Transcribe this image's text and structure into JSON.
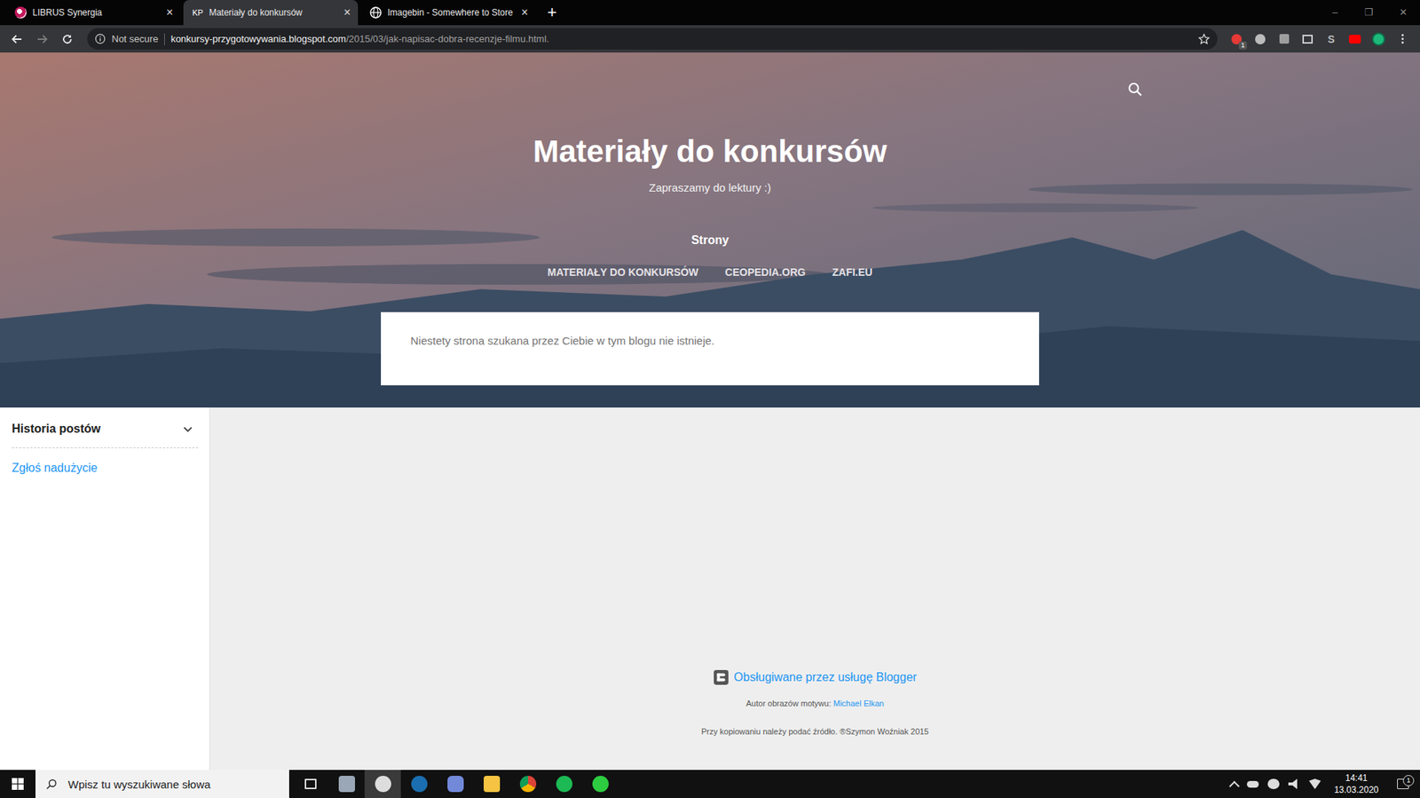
{
  "browser": {
    "tabs": [
      {
        "label": "LIBRUS Synergia",
        "selected": false,
        "favicon": "librus",
        "close": "×"
      },
      {
        "label": "Materiały do konkursów",
        "selected": true,
        "favicon": "text",
        "favicon_text": "KP",
        "close": "×"
      },
      {
        "label": "Imagebin - Somewhere to Store",
        "selected": false,
        "favicon": "globe",
        "close": "×"
      }
    ],
    "new_tab": "+",
    "window_controls": [
      "–",
      "❐",
      "✕"
    ],
    "address": {
      "security": "Not secure",
      "host": "konkursy-przygotowywania.blogspot.com",
      "path": "/2015/03/jak-napisac-dobra-recenzje-filmu.html."
    },
    "extension_badge": "1",
    "extension_letter": "S"
  },
  "blog": {
    "title": "Materiały do konkursów",
    "subtitle": "Zapraszamy do lektury :)",
    "pages_heading": "Strony",
    "pages": [
      "MATERIAŁY DO KONKURSÓW",
      "CEOPEDIA.ORG",
      "ZAFI.EU"
    ],
    "message": "Niestety strona szukana przez Ciebie w tym blogu nie istnieje."
  },
  "sidebar": {
    "heading": "Historia postów",
    "expanded": false,
    "report_link": "Zgłoś nadużycie"
  },
  "footer": {
    "powered": "Obsługiwane przez usługę Blogger",
    "credit_label": "Autor obrazów motywu:",
    "credit_author": "Michael Elkan",
    "copyright": "Przy kopiowaniu należy podać źródło. ®Szymon Woźniak 2015"
  },
  "taskbar": {
    "search_placeholder": "Wpisz tu wyszukiwane słowa",
    "apps": [
      {
        "kind": "task-view",
        "selected": false
      },
      {
        "kind": "mail",
        "selected": false
      },
      {
        "kind": "photos",
        "selected": true
      },
      {
        "kind": "steam",
        "selected": false
      },
      {
        "kind": "discord",
        "selected": false
      },
      {
        "kind": "explorer",
        "selected": false
      },
      {
        "kind": "chrome",
        "selected": false
      },
      {
        "kind": "spotify",
        "selected": false
      },
      {
        "kind": "green",
        "selected": false
      }
    ],
    "time": "14:41",
    "date": "13.03.2020",
    "notifications": "1"
  }
}
